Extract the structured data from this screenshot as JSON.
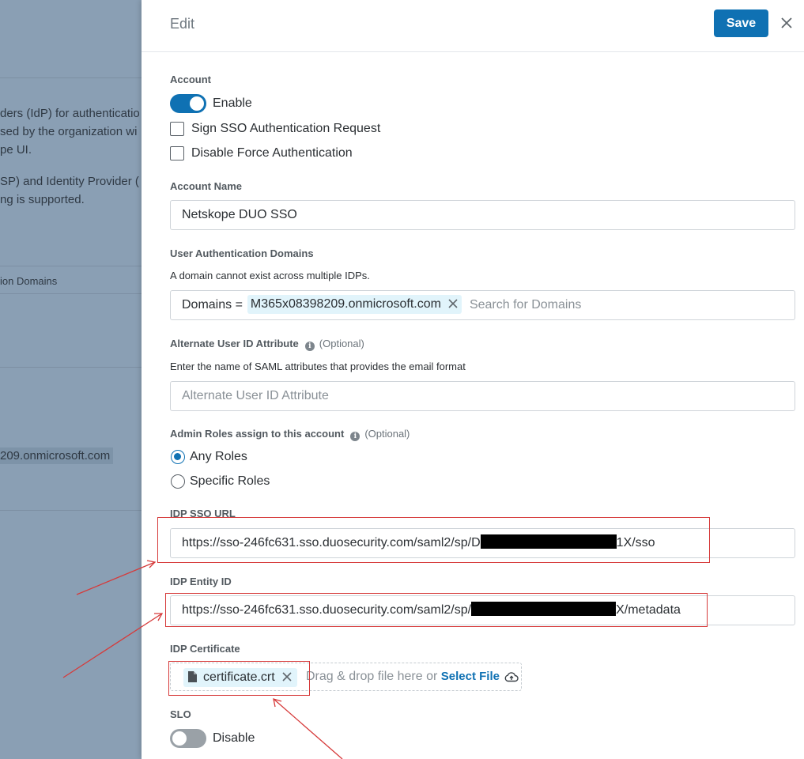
{
  "background": {
    "text_lines": [
      "ders (IdP) for authenticatio",
      "sed by the organization wi",
      "pe UI.",
      "SP) and Identity Provider (",
      "ng is supported."
    ],
    "column_header": "ion Domains",
    "domain_value": "209.onmicrosoft.com"
  },
  "header": {
    "title": "Edit",
    "save_label": "Save"
  },
  "account": {
    "label": "Account",
    "enable_label": "Enable",
    "enabled": true,
    "sign_sso_label": "Sign SSO Authentication Request",
    "sign_sso_checked": false,
    "disable_force_label": "Disable Force Authentication",
    "disable_force_checked": false
  },
  "account_name": {
    "label": "Account Name",
    "value": "Netskope DUO SSO"
  },
  "user_auth_domains": {
    "label": "User Authentication Domains",
    "hint": "A domain cannot exist across multiple IDPs.",
    "prefix": "Domains =",
    "chips": [
      "M365x08398209.onmicrosoft.com"
    ],
    "search_placeholder": "Search for Domains"
  },
  "alt_user_id": {
    "label": "Alternate User ID Attribute",
    "optional": "(Optional)",
    "hint": "Enter the name of SAML attributes that provides the email format",
    "placeholder": "Alternate User ID Attribute"
  },
  "admin_roles": {
    "label": "Admin Roles assign to this account",
    "optional": "(Optional)",
    "options": [
      "Any Roles",
      "Specific Roles"
    ],
    "selected": "Any Roles"
  },
  "idp_sso_url": {
    "label": "IDP SSO URL",
    "value_start": "https://sso-246fc631.sso.duosecurity.com/saml2/sp/D",
    "value_end": "1X/sso"
  },
  "idp_entity_id": {
    "label": "IDP Entity ID",
    "value_start": "https://sso-246fc631.sso.duosecurity.com/saml2/sp/",
    "value_end": "X/metadata"
  },
  "idp_certificate": {
    "label": "IDP Certificate",
    "file_name": "certificate.crt",
    "drop_text": "Drag & drop file here or",
    "select_file_label": "Select File"
  },
  "slo": {
    "label": "SLO",
    "toggle_label": "Disable",
    "enabled": false
  },
  "icons": {
    "close": "close-icon",
    "info": "info-icon",
    "file": "file-icon",
    "upload": "cloud-upload-icon",
    "chip_remove": "close-icon"
  },
  "colors": {
    "primary": "#0f71b3",
    "chip_bg": "#e1f4fb",
    "annotation": "#d63a3a",
    "overlay": "#8a9fb4"
  }
}
